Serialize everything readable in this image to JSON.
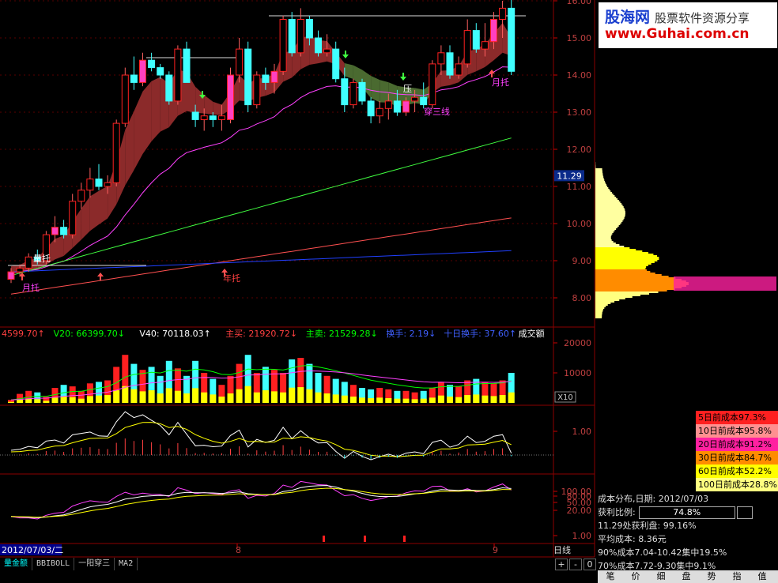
{
  "chart_data": {
    "type": "candlestick",
    "price_axis": {
      "ticks": [
        "16.00",
        "15.00",
        "14.00",
        "13.00",
        "12.00",
        "11.00",
        "10.00",
        "9.00",
        "8.00"
      ],
      "current": "11.29"
    },
    "date_axis": {
      "current_date": "2012/07/03/二",
      "month_labels": [
        "8",
        "9"
      ]
    },
    "candles": [
      [
        8.5,
        8.8,
        8.4,
        8.7
      ],
      [
        8.7,
        8.9,
        8.6,
        8.8
      ],
      [
        8.8,
        9.2,
        8.7,
        9.1
      ],
      [
        9.1,
        9.3,
        8.9,
        9.0
      ],
      [
        9.0,
        9.8,
        8.9,
        9.7
      ],
      [
        9.7,
        10.2,
        9.5,
        9.9
      ],
      [
        9.9,
        10.1,
        9.6,
        9.7
      ],
      [
        9.7,
        10.8,
        9.6,
        10.6
      ],
      [
        10.6,
        11.1,
        10.4,
        10.9
      ],
      [
        10.9,
        11.5,
        10.7,
        11.2
      ],
      [
        11.2,
        11.6,
        10.9,
        11.0
      ],
      [
        11.0,
        11.3,
        10.8,
        11.1
      ],
      [
        11.1,
        12.8,
        11.0,
        12.7
      ],
      [
        12.7,
        14.2,
        12.6,
        14.0
      ],
      [
        14.0,
        14.5,
        13.6,
        13.8
      ],
      [
        13.8,
        14.6,
        13.7,
        14.4
      ],
      [
        14.4,
        14.6,
        14.1,
        14.2
      ],
      [
        14.2,
        14.3,
        13.9,
        14.0
      ],
      [
        14.0,
        14.1,
        13.2,
        13.3
      ],
      [
        13.3,
        14.8,
        13.2,
        14.7
      ],
      [
        14.7,
        14.9,
        13.8,
        13.8
      ],
      [
        13.0,
        13.2,
        12.6,
        12.8
      ],
      [
        12.8,
        13.1,
        12.5,
        12.9
      ],
      [
        12.9,
        13.0,
        12.6,
        12.8
      ],
      [
        12.8,
        13.2,
        12.5,
        12.9
      ],
      [
        12.8,
        14.2,
        12.7,
        14.0
      ],
      [
        14.0,
        15.0,
        13.8,
        14.7
      ],
      [
        14.7,
        14.9,
        13.0,
        13.2
      ],
      [
        13.2,
        14.1,
        13.1,
        14.0
      ],
      [
        14.0,
        14.2,
        13.6,
        13.8
      ],
      [
        13.8,
        14.3,
        13.5,
        14.1
      ],
      [
        14.1,
        15.6,
        14.0,
        15.5
      ],
      [
        15.5,
        15.7,
        14.5,
        14.6
      ],
      [
        14.6,
        15.8,
        14.5,
        15.5
      ],
      [
        15.5,
        15.6,
        14.8,
        15.0
      ],
      [
        15.0,
        15.2,
        14.5,
        14.6
      ],
      [
        14.6,
        15.1,
        14.5,
        14.7
      ],
      [
        14.7,
        14.9,
        13.8,
        13.9
      ],
      [
        13.9,
        14.2,
        13.0,
        13.2
      ],
      [
        13.2,
        13.9,
        13.1,
        13.8
      ],
      [
        13.8,
        13.9,
        13.2,
        13.3
      ],
      [
        13.3,
        13.4,
        12.7,
        12.9
      ],
      [
        12.9,
        13.3,
        12.7,
        13.1
      ],
      [
        13.1,
        13.5,
        12.8,
        13.3
      ],
      [
        13.3,
        13.6,
        12.9,
        13.0
      ],
      [
        13.0,
        13.4,
        12.9,
        13.3
      ],
      [
        13.3,
        13.6,
        13.0,
        13.4
      ],
      [
        13.4,
        13.8,
        13.1,
        13.2
      ],
      [
        13.2,
        14.4,
        13.1,
        14.3
      ],
      [
        14.3,
        14.8,
        14.0,
        14.6
      ],
      [
        14.6,
        14.8,
        13.9,
        14.0
      ],
      [
        14.0,
        14.5,
        13.9,
        14.3
      ],
      [
        14.3,
        15.5,
        14.2,
        15.2
      ],
      [
        15.2,
        15.4,
        14.6,
        14.7
      ],
      [
        14.7,
        15.4,
        14.5,
        14.9
      ],
      [
        14.9,
        15.7,
        14.7,
        15.5
      ],
      [
        15.5,
        16.0,
        15.0,
        15.8
      ],
      [
        15.8,
        16.3,
        14.0,
        14.1
      ]
    ],
    "annotations": [
      "量托",
      "月托",
      "年托",
      "压",
      "穿三线",
      "月托"
    ],
    "volume": {
      "header": [
        {
          "text": "4599.70↑",
          "color": "#ff4040"
        },
        {
          "text": "V20: 66399.70↓",
          "color": "#00ff00"
        },
        {
          "text": "V40: 70118.03↑",
          "color": "#ffffff"
        },
        {
          "text": "主买: 21920.72↓",
          "color": "#ff4040"
        },
        {
          "text": "主卖: 21529.28↓",
          "color": "#00ff00"
        },
        {
          "text": "换手: 2.19↓",
          "color": "#4060ff"
        },
        {
          "text": "十日换手: 37.60↑",
          "color": "#4060ff"
        },
        {
          "text": "成交额",
          "color": "#ffffff"
        }
      ],
      "ticks": [
        "20000",
        "10000"
      ],
      "unit": "X10",
      "values": [
        1000,
        3000,
        4000,
        3500,
        2000,
        5000,
        6000,
        5500,
        4000,
        6500,
        7000,
        7500,
        12000,
        16000,
        13000,
        11000,
        12000,
        9000,
        14000,
        11500,
        9000,
        14000,
        10000,
        8000,
        6000,
        9000,
        13000,
        16000,
        10000,
        12000,
        11000,
        10000,
        14500,
        15000,
        13000,
        10000,
        9000,
        8000,
        7000,
        6000,
        5000,
        4500,
        5000,
        4500,
        4000,
        4000,
        3500,
        4000,
        5000,
        7000,
        6000,
        5500,
        7500,
        8000,
        7000,
        6500,
        7500,
        10000
      ]
    },
    "indicator2": {
      "ticks": [
        "1.00"
      ]
    },
    "indicator3": {
      "ticks": [
        "100.00",
        "80.00",
        "50.00",
        "20.00",
        "1.00"
      ]
    },
    "cost_distribution": {
      "legend": [
        {
          "text": "5日前成本97.3%",
          "color": "#ff2020"
        },
        {
          "text": "10日前成本95.8%",
          "color": "#ff9090"
        },
        {
          "text": "20日前成本91.2%",
          "color": "#ff20a0"
        },
        {
          "text": "30日前成本84.7%",
          "color": "#ff8c00"
        },
        {
          "text": "60日前成本52.2%",
          "color": "#ffff00"
        },
        {
          "text": "100日前成本28.8%",
          "color": "#ffff80"
        }
      ],
      "date_label": "成本分布,日期: 2012/07/03",
      "profit_label": "获利比例:",
      "profit_value": "74.8%",
      "rows": [
        "11.29处获利盘: 99.16%",
        "平均成本: 8.36元",
        "90%成本7.04-10.42集中19.5%",
        "70%成本7.72-9.30集中9.1%"
      ]
    }
  },
  "logo": {
    "line1": "股海网",
    "line1b": "股票软件资源分享",
    "line2": "www.Guhai.com.cn"
  },
  "tabs": [
    "量金额",
    "BBIBOLL",
    "一阳穿三",
    "MA2"
  ],
  "period": "日线",
  "zoom": [
    "+",
    "-",
    "0"
  ],
  "bottom_menu": [
    "笔",
    "价",
    "细",
    "盘",
    "势",
    "指",
    "值"
  ]
}
